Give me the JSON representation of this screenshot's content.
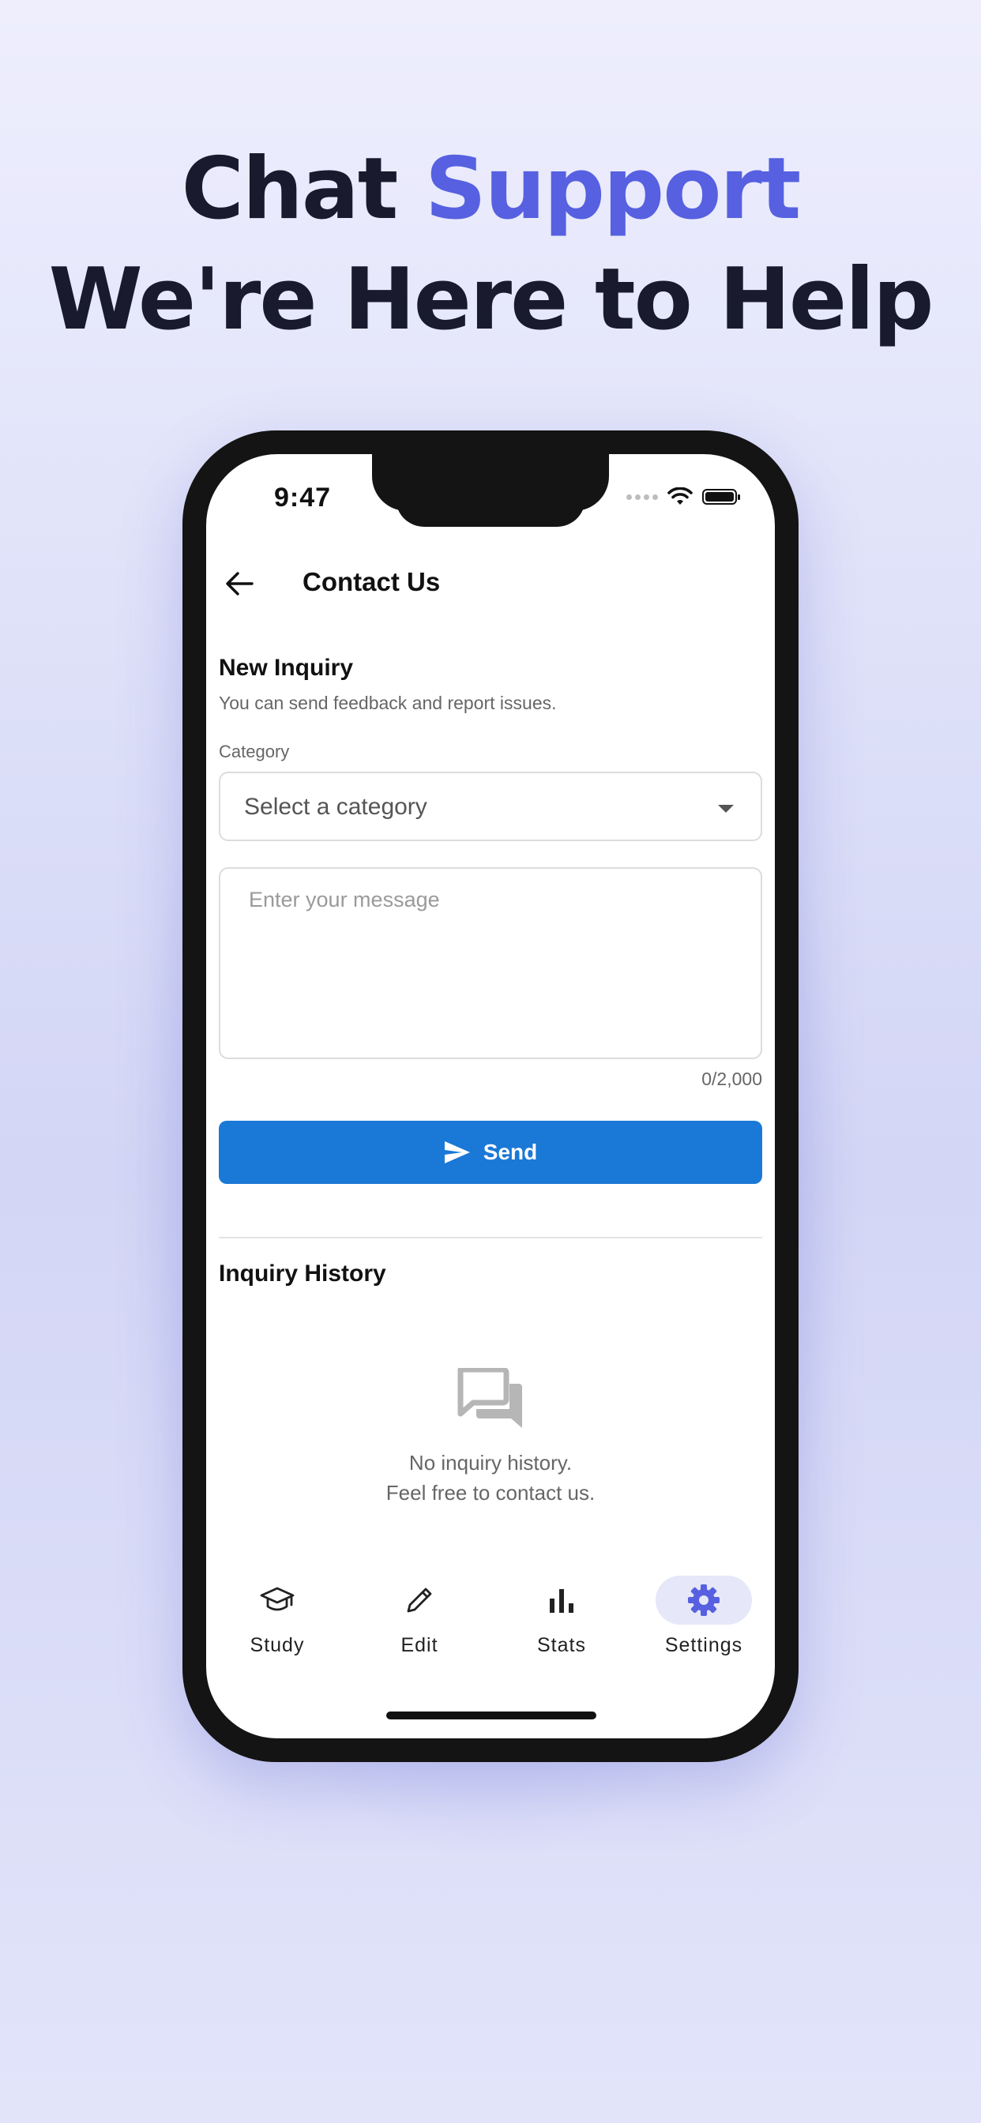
{
  "headline": {
    "line1_part1": "Chat",
    "line1_accent": "Support",
    "line2": "We're Here to Help",
    "accent_color": "#5660e0"
  },
  "status_bar": {
    "time": "9:47",
    "icons": [
      "signal-dots-icon",
      "wifi-icon",
      "battery-icon"
    ]
  },
  "app_bar": {
    "back_icon": "arrow-left-icon",
    "title": "Contact Us"
  },
  "new_inquiry": {
    "title": "New Inquiry",
    "subtitle": "You can send feedback and report issues.",
    "category_label": "Category",
    "category_placeholder": "Select a category",
    "message_placeholder": "Enter your message",
    "message_value": "",
    "char_count": "0/2,000",
    "send_label": "Send",
    "send_color": "#1a78d6"
  },
  "history": {
    "title": "Inquiry History",
    "empty_icon": "chat-bubbles-icon",
    "empty_line1": "No inquiry history.",
    "empty_line2": "Feel free to contact us."
  },
  "bottom_nav": {
    "items": [
      {
        "label": "Study",
        "icon": "graduation-cap-icon",
        "active": false
      },
      {
        "label": "Edit",
        "icon": "pencil-icon",
        "active": false
      },
      {
        "label": "Stats",
        "icon": "bar-chart-icon",
        "active": false
      },
      {
        "label": "Settings",
        "icon": "gear-icon",
        "active": true
      }
    ],
    "active_color": "#5660e0"
  }
}
